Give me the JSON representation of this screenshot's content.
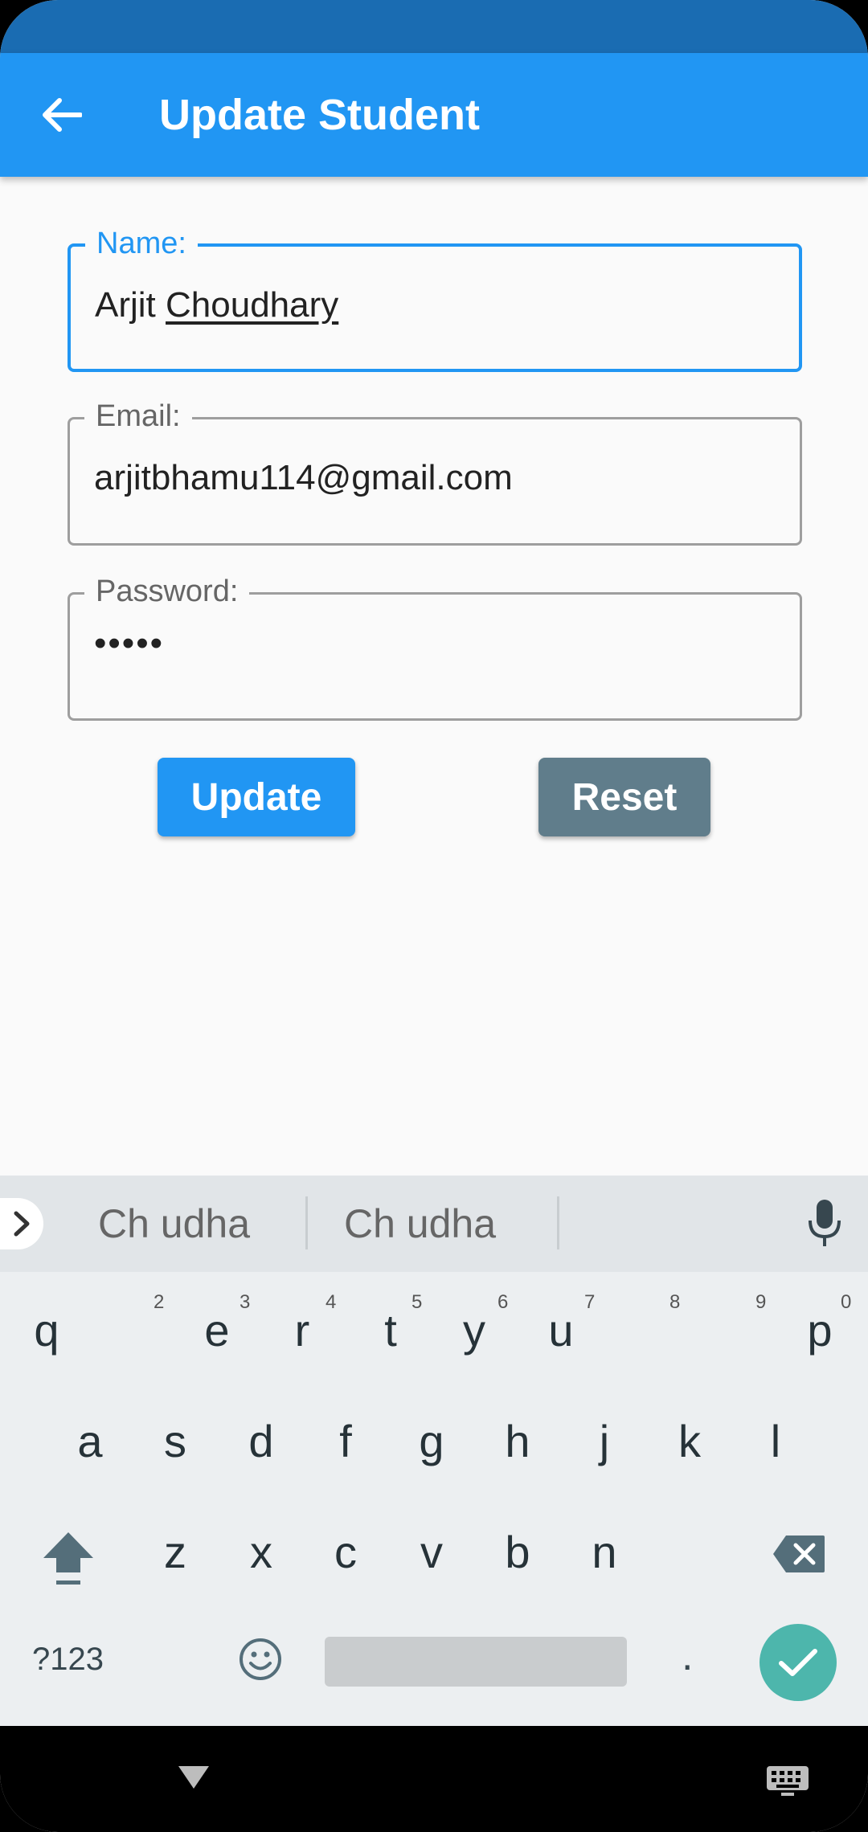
{
  "app_bar": {
    "title": "Update Student"
  },
  "form": {
    "name": {
      "label": "Name:",
      "value_first": "Arjit",
      "value_second": "Choudhary"
    },
    "email": {
      "label": "Email:",
      "value": "arjitbhamu114@gmail.com"
    },
    "password": {
      "label": "Password:",
      "value": "•••••"
    },
    "update_label": "Update",
    "reset_label": "Reset"
  },
  "keyboard": {
    "suggestions": [
      "Ch  udha",
      "Ch  udha"
    ],
    "row1": [
      "q",
      "e",
      "r",
      "t",
      "y",
      "u",
      "p"
    ],
    "row1_hints": [
      "2",
      "3",
      "4",
      "5",
      "6",
      "7",
      "8",
      "9",
      "0"
    ],
    "row2": [
      "a",
      "s",
      "d",
      "f",
      "g",
      "h",
      "j",
      "k",
      "l"
    ],
    "row3": [
      "z",
      "x",
      "c",
      "v",
      "b",
      "n"
    ],
    "symbols_label": "?123",
    "period_label": "."
  },
  "colors": {
    "primary": "#2196f3",
    "status_bar": "#1a6cb2",
    "reset": "#607d8b",
    "enter": "#4db6ac"
  }
}
